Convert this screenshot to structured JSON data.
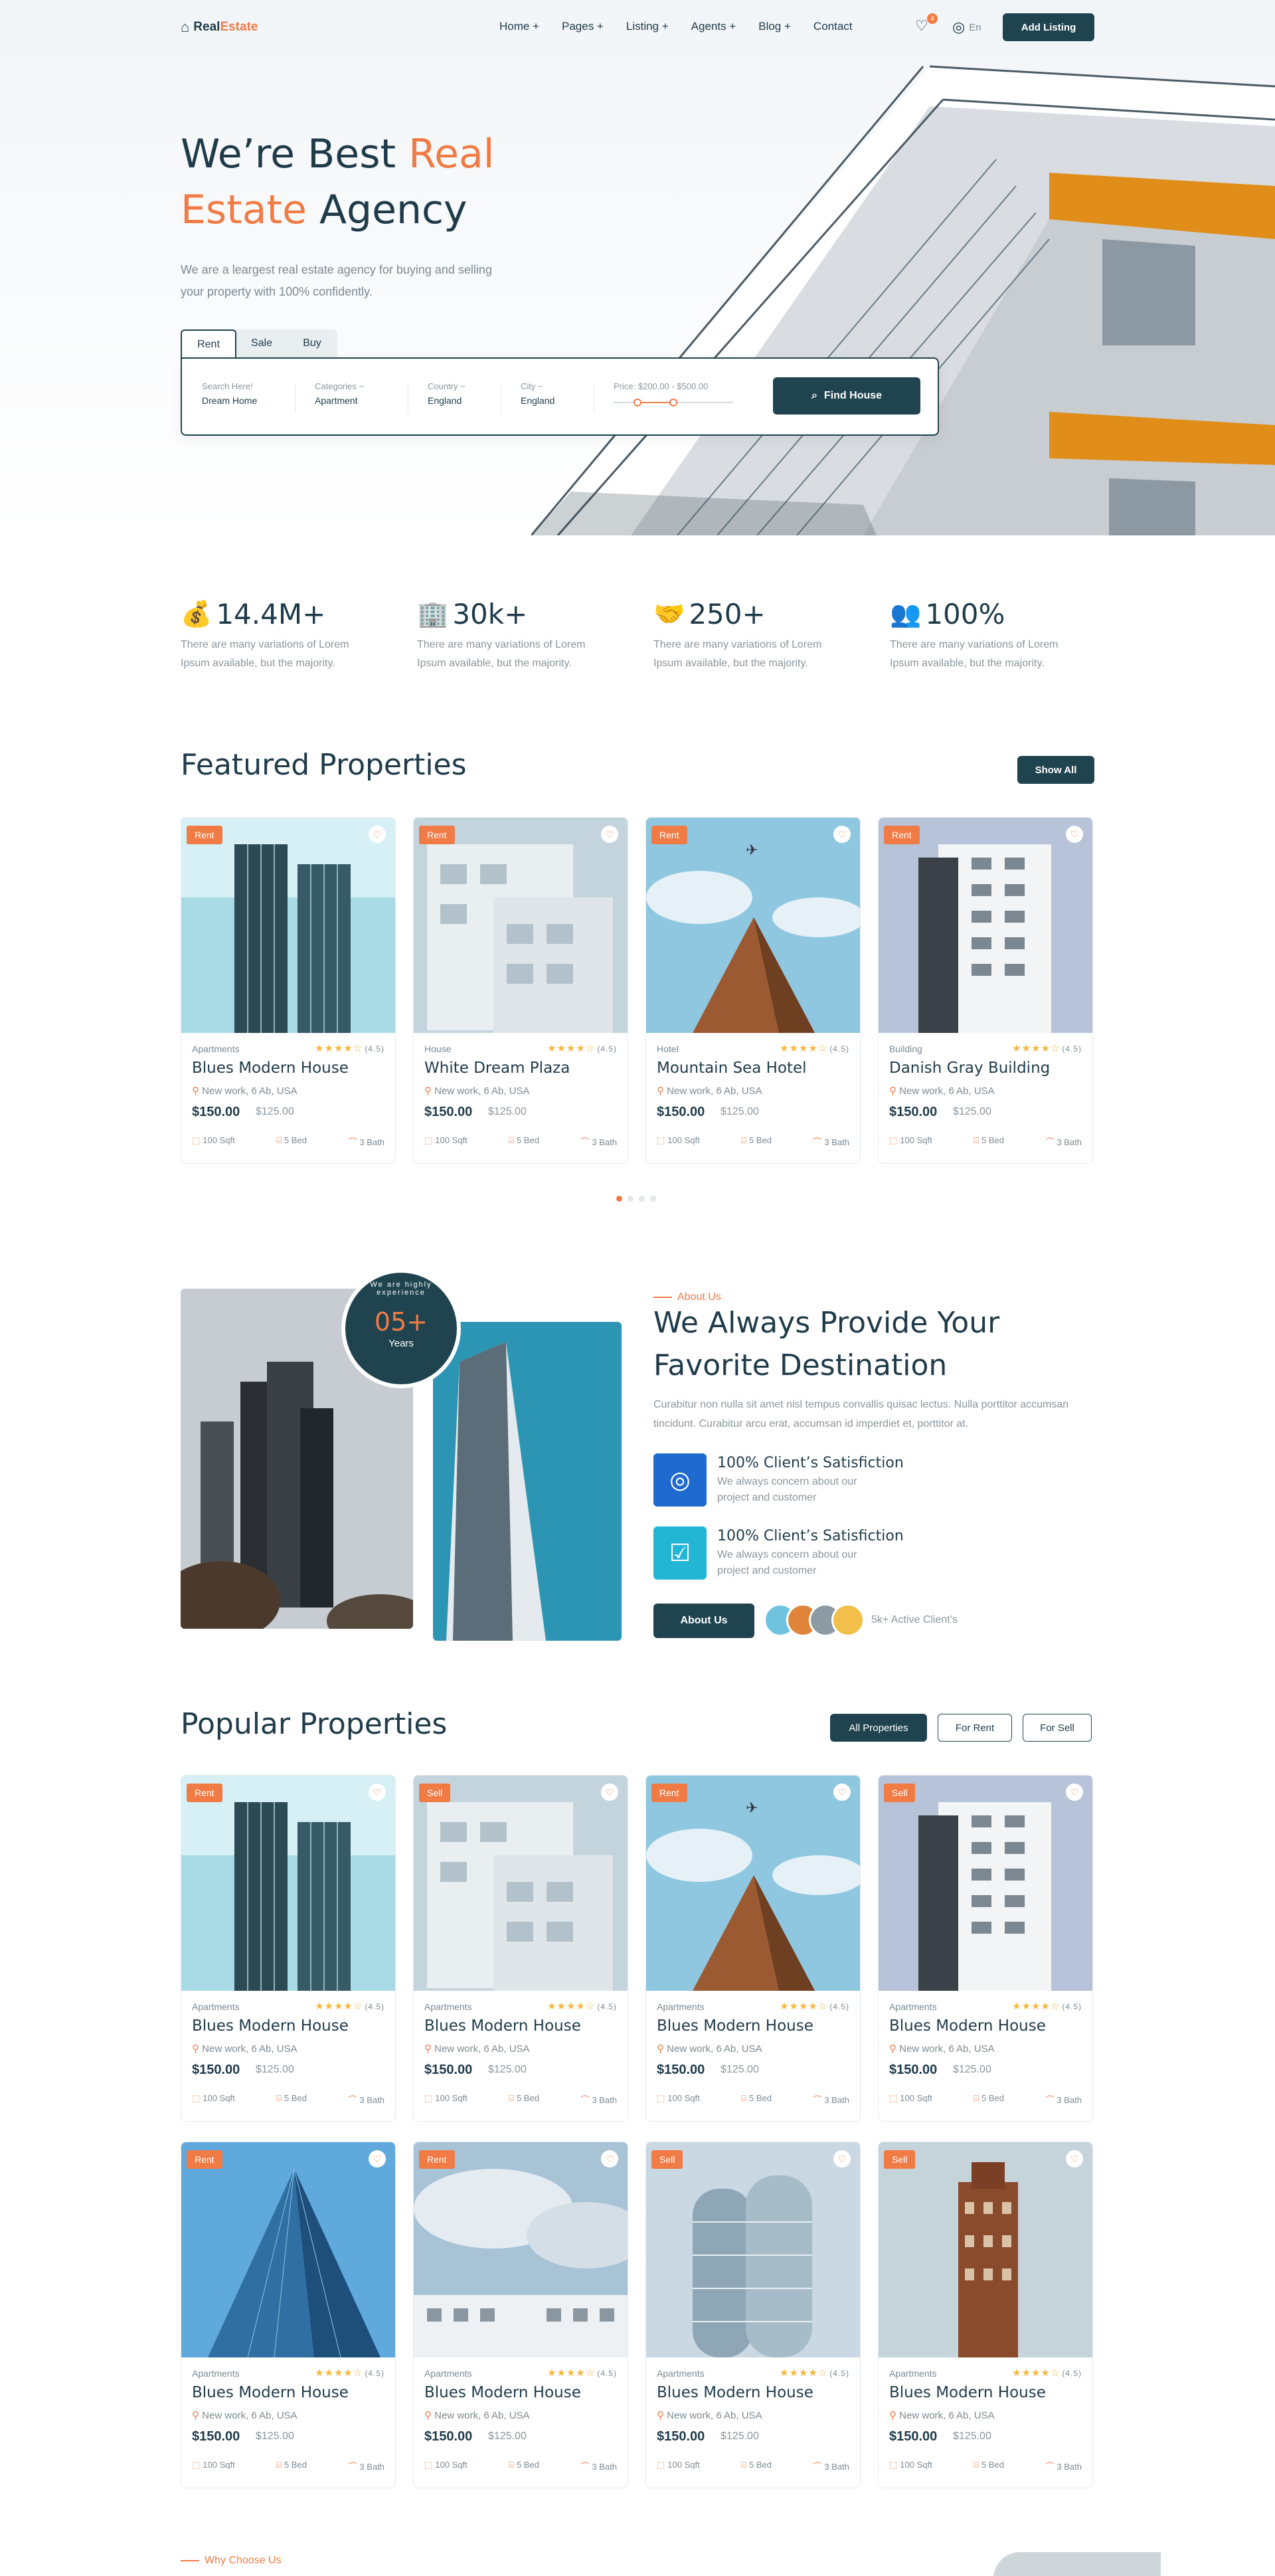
{
  "brand": {
    "name_part1": "Real",
    "name_part2": "Estate"
  },
  "nav": {
    "items": [
      "Home +",
      "Pages +",
      "Listing +",
      "Agents +",
      "Blog +",
      "Contact"
    ],
    "wishlist_count": "4",
    "language": "En",
    "add_listing": "Add Listing"
  },
  "hero": {
    "title_part1": "We’re Best ",
    "title_accent1": "Real",
    "title_accent2": "Estate",
    "title_part2": " Agency",
    "subtitle": "We are a leargest real estate agency for buying and selling your property with 100% confidently.",
    "tabs": [
      "Rent",
      "Sale",
      "Buy"
    ],
    "search": {
      "label": "Search Here!",
      "value": "Dream Home"
    },
    "categories": {
      "label": "Categories ~",
      "value": "Apartment"
    },
    "country": {
      "label": "Country ~",
      "value": "England"
    },
    "city": {
      "label": "City ~",
      "value": "England"
    },
    "price": {
      "label": "Price: $200.00 - $500.00",
      "low": 0.2,
      "high": 0.5
    },
    "find": "Find House"
  },
  "stats": [
    {
      "value": "14.4M+",
      "desc": "There are many variations of Lorem Ipsum available, but the majority.",
      "icon": "money-hand-icon"
    },
    {
      "value": "30k+",
      "desc": "There are many variations of Lorem Ipsum available, but the majority.",
      "icon": "buildings-icon"
    },
    {
      "value": "250+",
      "desc": "There are many variations of Lorem Ipsum available, but the majority.",
      "icon": "handshake-icon"
    },
    {
      "value": "100%",
      "desc": "There are many variations of Lorem Ipsum available, but the majority.",
      "icon": "clients-icon"
    }
  ],
  "featured": {
    "title": "Featured Properties",
    "show_all": "Show All",
    "cards": [
      {
        "tag": "Rent",
        "type": "Apartments",
        "rating": "(4.5)",
        "name": "Blues Modern House",
        "location": "New work, 6 Ab, USA",
        "price": "$150.00",
        "old": "$125.00",
        "sqft": "100 Sqft",
        "bed": "5 Bed",
        "bath": "3 Bath"
      },
      {
        "tag": "Rent",
        "type": "House",
        "rating": "(4.5)",
        "name": "White Dream Plaza",
        "location": "New work, 6 Ab, USA",
        "price": "$150.00",
        "old": "$125.00",
        "sqft": "100 Sqft",
        "bed": "5 Bed",
        "bath": "3 Bath"
      },
      {
        "tag": "Rent",
        "type": "Hotel",
        "rating": "(4.5)",
        "name": "Mountain Sea Hotel",
        "location": "New work, 6 Ab, USA",
        "price": "$150.00",
        "old": "$125.00",
        "sqft": "100 Sqft",
        "bed": "5 Bed",
        "bath": "3 Bath"
      },
      {
        "tag": "Rent",
        "type": "Building",
        "rating": "(4.5)",
        "name": "Danish Gray Building",
        "location": "New work, 6 Ab, USA",
        "price": "$150.00",
        "old": "$125.00",
        "sqft": "100 Sqft",
        "bed": "5 Bed",
        "bath": "3 Bath"
      }
    ]
  },
  "about": {
    "eyebrow": "About Us",
    "title": "We Always Provide Your Favorite Destination",
    "text": "Curabitur non nulla sit amet nisl tempus convallis quisac lectus. Nulla porttitor accumsan tincidunt. Curabitur arcu erat, accumsan id imperdiet et, porttitor at.",
    "badge_num": "05+",
    "badge_sub": "Years",
    "badge_ring": "We are highly experience",
    "features": [
      {
        "title": "100% Client’s Satisfiction",
        "text": "We always concern about our project and customer"
      },
      {
        "title": "100% Client’s Satisfiction",
        "text": "We always concern about our project and customer"
      }
    ],
    "button": "About Us",
    "clients": "5k+ Active Client’s"
  },
  "popular": {
    "title": "Popular Properties",
    "filters": [
      "All Properties",
      "For Rent",
      "For Sell"
    ],
    "cards": [
      {
        "tag": "Rent",
        "type": "Apartments",
        "rating": "(4.5)",
        "name": "Blues Modern House",
        "location": "New work, 6 Ab, USA",
        "price": "$150.00",
        "old": "$125.00",
        "sqft": "100 Sqft",
        "bed": "5 Bed",
        "bath": "3 Bath"
      },
      {
        "tag": "Sell",
        "type": "Apartments",
        "rating": "(4.5)",
        "name": "Blues Modern House",
        "location": "New work, 6 Ab, USA",
        "price": "$150.00",
        "old": "$125.00",
        "sqft": "100 Sqft",
        "bed": "5 Bed",
        "bath": "3 Bath"
      },
      {
        "tag": "Rent",
        "type": "Apartments",
        "rating": "(4.5)",
        "name": "Blues Modern House",
        "location": "New work, 6 Ab, USA",
        "price": "$150.00",
        "old": "$125.00",
        "sqft": "100 Sqft",
        "bed": "5 Bed",
        "bath": "3 Bath"
      },
      {
        "tag": "Sell",
        "type": "Apartments",
        "rating": "(4.5)",
        "name": "Blues Modern House",
        "location": "New work, 6 Ab, USA",
        "price": "$150.00",
        "old": "$125.00",
        "sqft": "100 Sqft",
        "bed": "5 Bed",
        "bath": "3 Bath"
      },
      {
        "tag": "Rent",
        "type": "Apartments",
        "rating": "(4.5)",
        "name": "Blues Modern House",
        "location": "New work, 6 Ab, USA",
        "price": "$150.00",
        "old": "$125.00",
        "sqft": "100 Sqft",
        "bed": "5 Bed",
        "bath": "3 Bath"
      },
      {
        "tag": "Rent",
        "type": "Apartments",
        "rating": "(4.5)",
        "name": "Blues Modern House",
        "location": "New work, 6 Ab, USA",
        "price": "$150.00",
        "old": "$125.00",
        "sqft": "100 Sqft",
        "bed": "5 Bed",
        "bath": "3 Bath"
      },
      {
        "tag": "Sell",
        "type": "Apartments",
        "rating": "(4.5)",
        "name": "Blues Modern House",
        "location": "New work, 6 Ab, USA",
        "price": "$150.00",
        "old": "$125.00",
        "sqft": "100 Sqft",
        "bed": "5 Bed",
        "bath": "3 Bath"
      },
      {
        "tag": "Sell",
        "type": "Apartments",
        "rating": "(4.5)",
        "name": "Blues Modern House",
        "location": "New work, 6 Ab, USA",
        "price": "$150.00",
        "old": "$125.00",
        "sqft": "100 Sqft",
        "bed": "5 Bed",
        "bath": "3 Bath"
      }
    ]
  },
  "why": {
    "eyebrow": "Why Choose Us"
  },
  "colors": {
    "accent": "#f07b45",
    "dark": "#1f4450"
  }
}
